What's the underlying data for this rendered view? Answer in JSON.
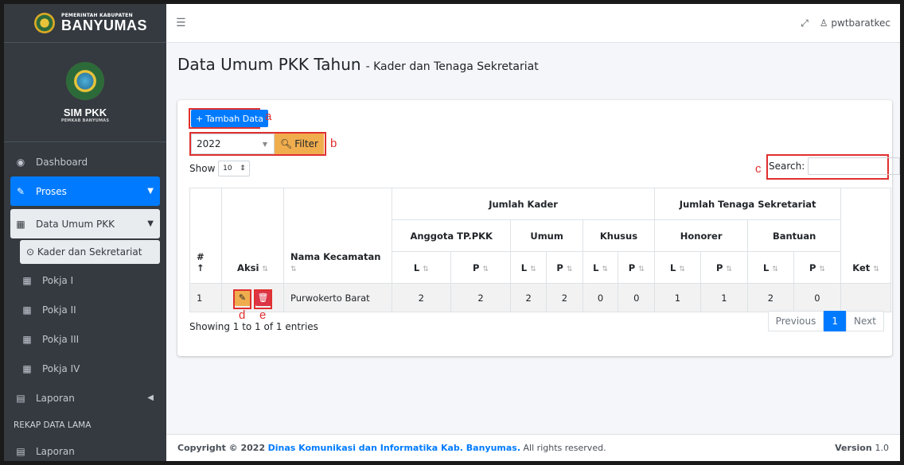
{
  "brand": {
    "small": "PEMERINTAH KABUPATEN",
    "big": "BANYUMAS"
  },
  "panel": {
    "app_name": "SIM PKK",
    "app_sub": "PEMKAB BANYUMAS"
  },
  "sidebar": {
    "dashboard": "Dashboard",
    "proses": "Proses",
    "data_umum": "Data Umum PKK",
    "kader": "Kader dan Sekretariat",
    "pokja1": "Pokja I",
    "pokja2": "Pokja II",
    "pokja3": "Pokja III",
    "pokja4": "Pokja IV",
    "laporan": "Laporan",
    "rekap_header": "REKAP DATA LAMA",
    "laporan2": "Laporan"
  },
  "topbar": {
    "user": "pwtbaratkec"
  },
  "page": {
    "title": "Data Umum PKK Tahun",
    "subtitle": "- Kader dan Tenaga Sekretariat"
  },
  "controls": {
    "add_label": "Tambah Data",
    "year": "2022",
    "filter_label": "Filter",
    "show_label": "Show",
    "show_value": "10",
    "search_label": "Search:"
  },
  "annotations": {
    "a": "a",
    "b": "b",
    "c": "c",
    "d": "d",
    "e": "e"
  },
  "table": {
    "h_no": "#",
    "h_aksi": "Aksi",
    "h_nama": "Nama Kecamatan",
    "h_kader": "Jumlah Kader",
    "h_tenaga": "Jumlah Tenaga Sekretariat",
    "h_ket": "Ket",
    "h_anggota": "Anggota TP.PKK",
    "h_umum": "Umum",
    "h_khusus": "Khusus",
    "h_honorer": "Honorer",
    "h_bantuan": "Bantuan",
    "h_l": "L",
    "h_p": "P",
    "row": {
      "no": "1",
      "nama": "Purwokerto Barat",
      "v1": "2",
      "v2": "2",
      "v3": "2",
      "v4": "2",
      "v5": "0",
      "v6": "0",
      "v7": "1",
      "v8": "1",
      "v9": "2",
      "v10": "0",
      "ket": ""
    }
  },
  "info": "Showing 1 to 1 of 1 entries",
  "pager": {
    "prev": "Previous",
    "page": "1",
    "next": "Next"
  },
  "footer": {
    "copyright": "Copyright © 2022",
    "org": "Dinas Komunikasi dan Informatika Kab. Banyumas.",
    "rights": "All rights reserved.",
    "version_label": "Version",
    "version": "1.0"
  },
  "colors": {
    "primary": "#007bff",
    "warning": "#f0ad4e",
    "danger": "#dc3545",
    "sidebar": "#343a40",
    "annotation": "#e0302f"
  }
}
